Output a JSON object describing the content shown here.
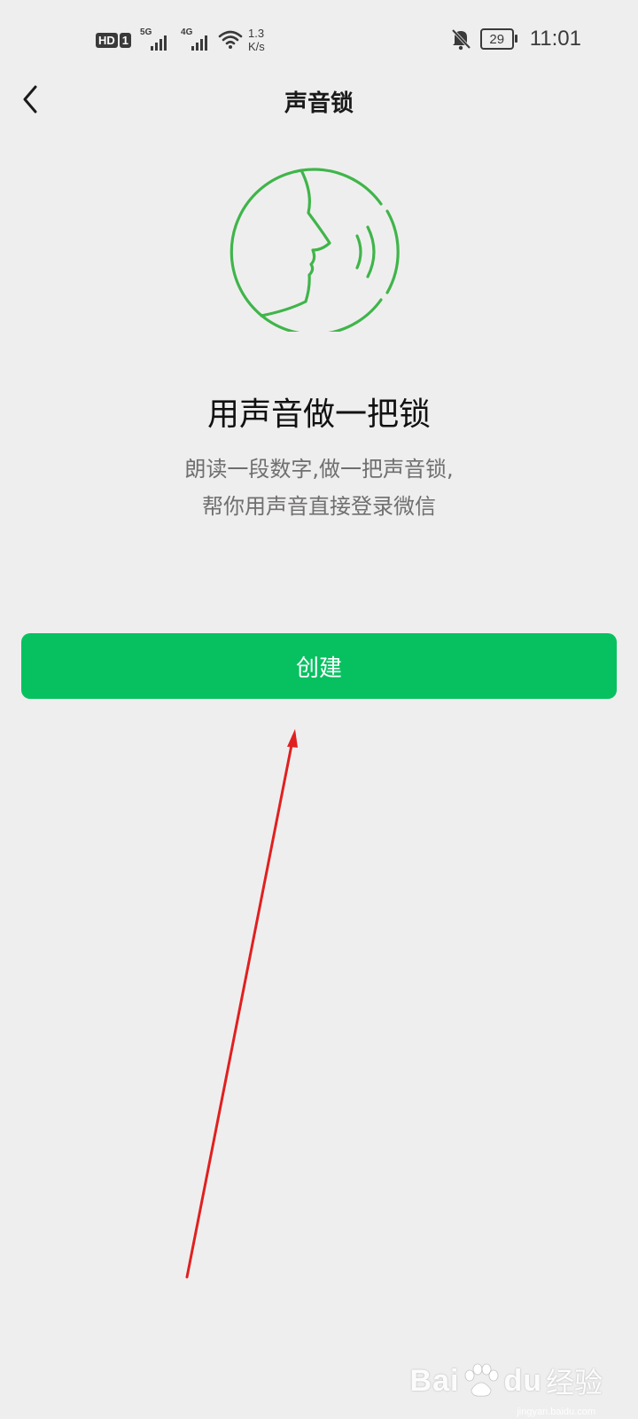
{
  "status_bar": {
    "hd_label": "HD",
    "sim_label": "1",
    "sim1_network": "5G",
    "sim2_network": "4G",
    "net_speed_value": "1.3",
    "net_speed_unit": "K/s",
    "battery_level": "29",
    "time": "11:01",
    "icons": [
      "signal-icon",
      "wifi-icon",
      "bell-muted-icon",
      "battery-icon"
    ]
  },
  "nav": {
    "back_icon": "chevron-left-icon",
    "title": "声音锁"
  },
  "illustration_icon": "face-speaking-icon",
  "main": {
    "headline": "用声音做一把锁",
    "desc_line1": "朗读一段数字,做一把声音锁,",
    "desc_line2": "帮你用声音直接登录微信",
    "create_button_label": "创建"
  },
  "annotation": {
    "arrow_color": "#e02020"
  },
  "colors": {
    "accent": "#07c160",
    "background": "#efeeee",
    "illustration_stroke": "#3fb54a"
  },
  "watermark": {
    "brand_left": "Bai",
    "brand_right": "du",
    "brand_cn": "经验",
    "url": "jingyan.baidu.com"
  }
}
